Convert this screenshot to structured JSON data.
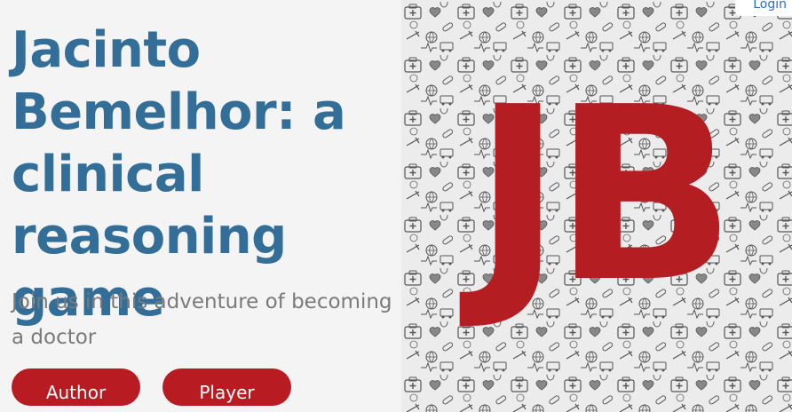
{
  "hero_section": {
    "title": "Jacinto Bemelhor: a clinical reasoning game",
    "subtitle": "Join us in this adventure of becoming a doctor",
    "buttons": {
      "author_label": "Author",
      "player_label": "Player"
    }
  },
  "image_panel": {
    "logo_text": "JB",
    "pattern": "medical-doodle-pattern",
    "logo_color": "#b41e23"
  },
  "header": {
    "login_label": "Login"
  },
  "colors": {
    "title": "#336e98",
    "subtitle": "#7a7a7a",
    "button_bg": "#b81c22",
    "link": "#2a6fd6"
  }
}
